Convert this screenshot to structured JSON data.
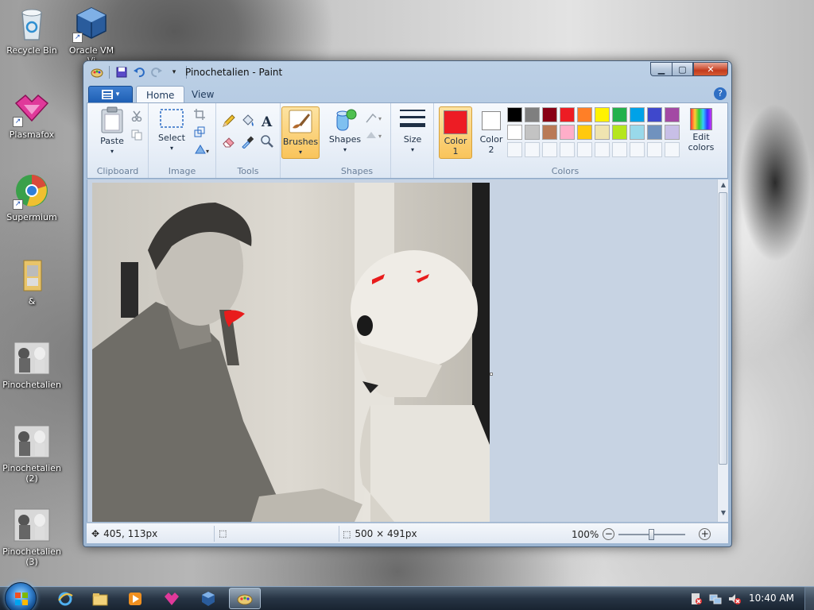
{
  "desktop": {
    "icons": [
      {
        "label": "Recycle Bin",
        "icon": "recycle-bin-icon"
      },
      {
        "label": "Oracle VM VirtualBox",
        "icon": "virtualbox-icon"
      },
      {
        "label": "Plasmafox",
        "icon": "plasmafox-icon"
      },
      {
        "label": "Supermium",
        "icon": "supermium-icon"
      },
      {
        "label": "&",
        "icon": "folder-icon"
      },
      {
        "label": "Pinochetalien",
        "icon": "image-file-icon"
      },
      {
        "label": "Pinochetalien (2)",
        "icon": "image-file-icon"
      },
      {
        "label": "Pinochetalien (3)",
        "icon": "image-file-icon"
      }
    ],
    "oracle_label_visible": "Oracle VM\nVi"
  },
  "window": {
    "title": "Pinochetalien - Paint",
    "menu_button": "▤ ▾",
    "tabs": [
      "Home",
      "View"
    ],
    "groups": {
      "clipboard": {
        "label": "Clipboard",
        "paste": "Paste"
      },
      "image": {
        "label": "Image",
        "select": "Select"
      },
      "tools": {
        "label": "Tools"
      },
      "brushes": {
        "label": "Brushes"
      },
      "shapes": {
        "label": "Shapes",
        "shapes_btn": "Shapes"
      },
      "size": {
        "label": "Size"
      },
      "colors": {
        "label": "Colors",
        "color1": "Color\n1",
        "color2": "Color\n2",
        "edit": "Edit\ncolors",
        "color1_value": "#ed1c24",
        "color2_value": "#ffffff",
        "row1": [
          "#000000",
          "#7f7f7f",
          "#880015",
          "#ed1c24",
          "#ff7f27",
          "#fff200",
          "#22b14c",
          "#00a2e8",
          "#3f48cc",
          "#a349a4"
        ],
        "row2": [
          "#ffffff",
          "#c3c3c3",
          "#b97a57",
          "#ffaec9",
          "#ffc90e",
          "#efe4b0",
          "#b5e61d",
          "#99d9ea",
          "#7092be",
          "#c8bfe7"
        ]
      }
    },
    "status": {
      "cursor_pos": "405, 113px",
      "image_size": "500 × 491px",
      "zoom": "100%"
    }
  },
  "taskbar": {
    "clock": "10:40 AM",
    "pinned": [
      "internet-explorer-icon",
      "explorer-icon",
      "media-player-icon",
      "plasmafox-icon",
      "virtualbox-icon",
      "paint-icon"
    ]
  }
}
